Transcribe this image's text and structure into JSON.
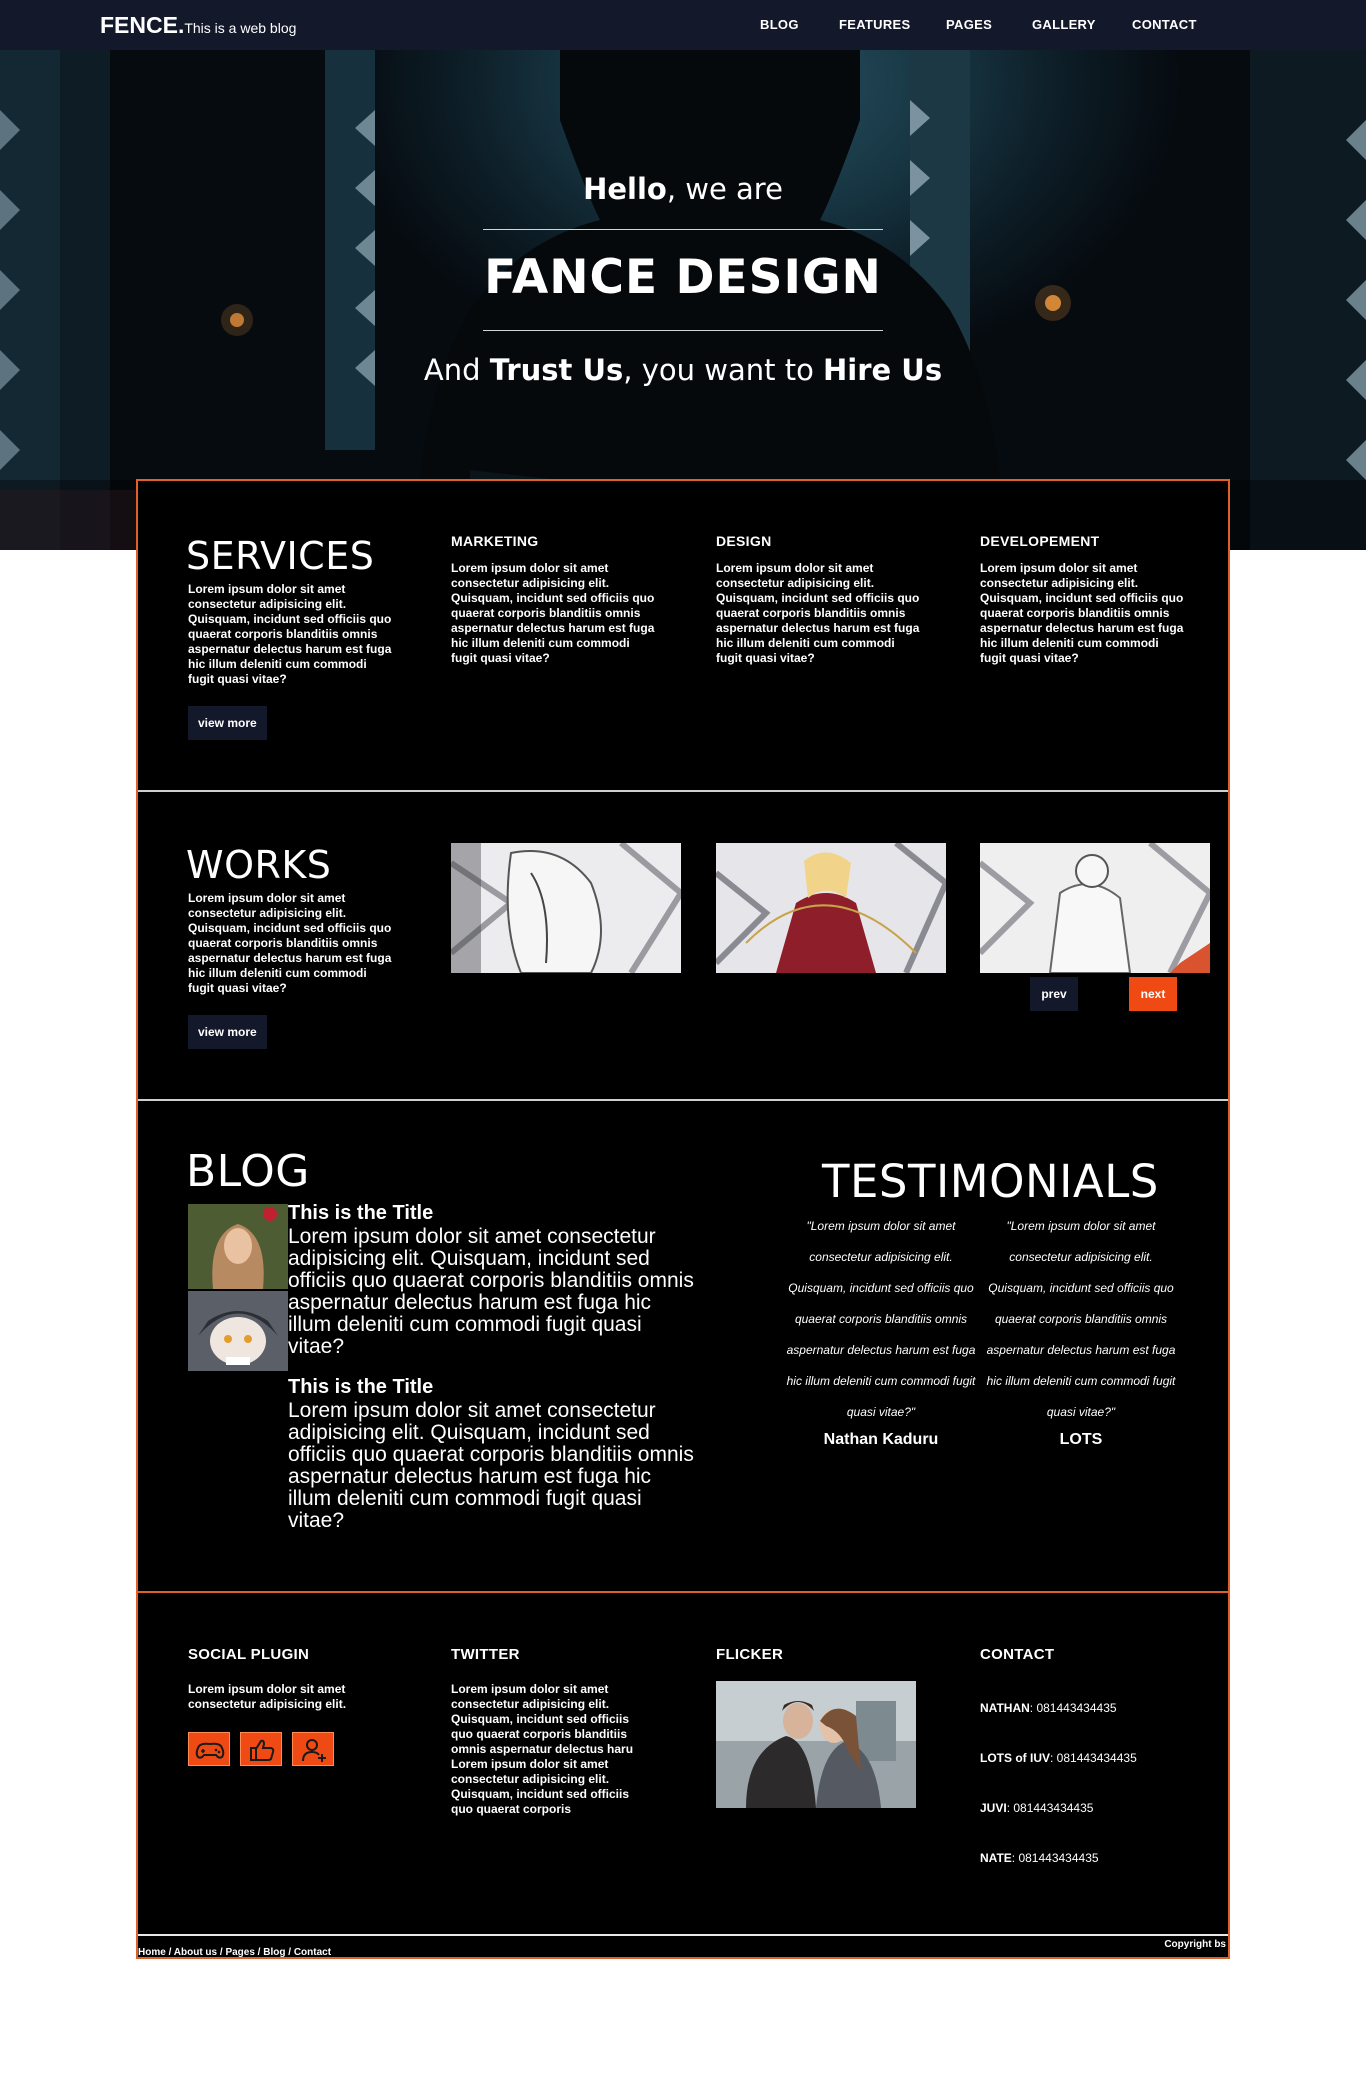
{
  "nav": {
    "brand": "FENCE.",
    "tagline": "This is a web blog",
    "links": [
      "BLOG",
      "FEATURES",
      "PAGES",
      "GALLERY",
      "CONTACT"
    ]
  },
  "hero": {
    "greeting_bold": "Hello",
    "greeting_rest": ", we are",
    "title": "FANCE DESIGN",
    "sub_1": "And ",
    "sub_bold_1": "Trust Us",
    "sub_2": ", you want to ",
    "sub_bold_2": "Hire Us"
  },
  "services": {
    "title": "SERVICES",
    "text": "Lorem ipsum dolor sit amet consectetur adipisicing elit. Quisquam, incidunt sed officiis quo quaerat corporis blanditiis omnis aspernatur delectus harum est fuga hic illum deleniti cum commodi fugit quasi vitae?",
    "button": "view more",
    "columns": [
      {
        "heading": "MARKETING",
        "text": "Lorem ipsum dolor sit amet consectetur adipisicing elit. Quisquam, incidunt sed officiis quo quaerat corporis blanditiis omnis aspernatur delectus harum est fuga hic illum deleniti cum commodi fugit quasi vitae?"
      },
      {
        "heading": "DESIGN",
        "text": "Lorem ipsum dolor sit amet consectetur adipisicing elit. Quisquam, incidunt sed officiis quo quaerat corporis blanditiis omnis aspernatur delectus harum est fuga hic illum deleniti cum commodi fugit quasi vitae?"
      },
      {
        "heading": "DEVELOPEMENT",
        "text": "Lorem ipsum dolor sit amet consectetur adipisicing elit. Quisquam, incidunt sed officiis quo quaerat corporis blanditiis omnis aspernatur delectus harum est fuga hic illum deleniti cum commodi fugit quasi vitae?"
      }
    ]
  },
  "works": {
    "title": "WORKS",
    "text": "Lorem ipsum dolor sit amet consectetur adipisicing elit. Quisquam, incidunt sed officiis quo quaerat corporis blanditiis omnis aspernatur delectus harum est fuga hic illum deleniti cum commodi fugit quasi vitae?",
    "button": "view more",
    "prev": "prev",
    "next": "next"
  },
  "blog": {
    "title": "BLOG",
    "posts": [
      {
        "title": "This is the Title",
        "text": "Lorem ipsum dolor sit amet consectetur adipisicing elit. Quisquam, incidunt sed officiis quo quaerat corporis blanditiis omnis aspernatur delectus harum est fuga hic illum deleniti cum commodi fugit quasi vitae?"
      },
      {
        "title": "This is the Title",
        "text": "Lorem ipsum dolor sit amet consectetur adipisicing elit. Quisquam, incidunt sed officiis quo quaerat corporis blanditiis omnis aspernatur delectus harum est fuga hic illum deleniti cum commodi fugit quasi vitae?"
      }
    ]
  },
  "testimonials": {
    "title": "TESTIMONIALS",
    "items": [
      {
        "quote": "\"Lorem ipsum dolor sit amet consectetur adipisicing elit. Quisquam, incidunt sed officiis quo quaerat corporis blanditiis omnis aspernatur delectus harum est fuga hic illum deleniti cum commodi fugit quasi vitae?\"",
        "name": "Nathan Kaduru"
      },
      {
        "quote": "\"Lorem ipsum dolor sit amet consectetur adipisicing elit. Quisquam, incidunt sed officiis quo quaerat corporis blanditiis omnis aspernatur delectus harum est fuga hic illum deleniti cum commodi fugit quasi vitae?\"",
        "name": "LOTS"
      }
    ]
  },
  "footer_cols": {
    "social": {
      "heading": "SOCIAL PLUGIN",
      "text": "Lorem ipsum dolor sit amet consectetur adipisicing elit."
    },
    "twitter": {
      "heading": "TWITTER",
      "text": "Lorem ipsum dolor sit amet consectetur adipisicing elit. Quisquam, incidunt sed officiis quo quaerat corporis blanditiis omnis aspernatur delectus haru Lorem ipsum dolor sit amet consectetur adipisicing elit. Quisquam, incidunt sed officiis quo quaerat corporis"
    },
    "flicker": {
      "heading": "FLICKER"
    },
    "contact": {
      "heading": "CONTACT",
      "rows": [
        {
          "name": "NATHAN",
          "phone": ": 081443434435"
        },
        {
          "name": "LOTS of IUV",
          "phone": ": 081443434435"
        },
        {
          "name": "JUVI",
          "phone": ": 081443434435"
        },
        {
          "name": "NATE",
          "phone": ": 081443434435"
        }
      ]
    }
  },
  "bottom": {
    "links": [
      "Home",
      "About us",
      "Pages",
      "Blog",
      "Contact"
    ],
    "separator": " / ",
    "copyright": "Copyright bs"
  },
  "colors": {
    "nav_bg": "#14182b",
    "accent": "#f04a14",
    "panel_bg": "#000000",
    "panel_border": "#e0602a"
  },
  "icons": [
    "gamepad-icon",
    "thumbs-up-icon",
    "add-user-icon"
  ]
}
